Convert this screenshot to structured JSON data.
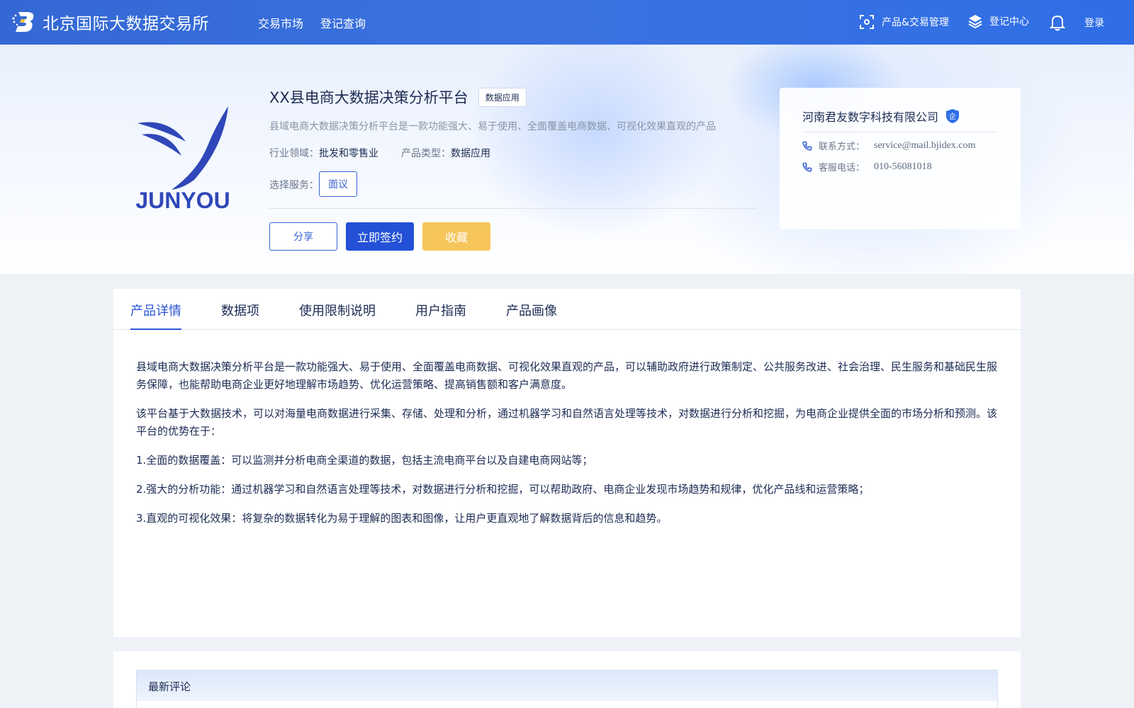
{
  "header": {
    "brand": "北京国际大数据交易所",
    "nav": [
      "交易市场",
      "登记查询"
    ],
    "product_mgmt": "产品&交易管理",
    "register_center": "登记中心",
    "login": "登录",
    "icons": [
      "scan-icon",
      "layers-icon",
      "bell-icon"
    ]
  },
  "product": {
    "logo_text": "JUNYOU",
    "title": "XX县电商大数据决策分析平台",
    "tag": "数据应用",
    "description": "县域电商大数据决策分析平台是一款功能强大、易于使用、全面覆盖电商数据、可视化效果直观的产品",
    "industry_label": "行业领域：",
    "industry_value": "批发和零售业",
    "type_label": "产品类型：",
    "type_value": "数据应用",
    "service_label": "选择服务：",
    "service_option": "面议",
    "buttons": {
      "share": "分享",
      "sign": "立即签约",
      "favorite": "收藏"
    }
  },
  "company": {
    "name": "河南君友数字科技有限公司",
    "badge": "企",
    "contact_label": "联系方式：",
    "contact_value": "service@mail.bjidex.com",
    "phone_label": "客服电话：",
    "phone_value": "010-56081018"
  },
  "tabs": [
    "产品详情",
    "数据项",
    "使用限制说明",
    "用户指南",
    "产品画像"
  ],
  "active_tab": "产品详情",
  "detail": {
    "paragraphs": [
      "县域电商大数据决策分析平台是一款功能强大、易于使用、全面覆盖电商数据、可视化效果直观的产品，可以辅助政府进行政策制定、公共服务改进、社会治理、民生服务和基础民生服务保障，也能帮助电商企业更好地理解市场趋势、优化运营策略、提高销售额和客户满意度。",
      "该平台基于大数据技术，可以对海量电商数据进行采集、存储、处理和分析，通过机器学习和自然语言处理等技术，对数据进行分析和挖掘，为电商企业提供全面的市场分析和预测。该平台的优势在于：",
      "1.全面的数据覆盖：可以监测并分析电商全渠道的数据，包括主流电商平台以及自建电商网站等；",
      "2.强大的分析功能：通过机器学习和自然语言处理等技术，对数据进行分析和挖掘，可以帮助政府、电商企业发现市场趋势和规律，优化产品线和运营策略；",
      "3.直观的可视化效果：将复杂的数据转化为易于理解的图表和图像，让用户更直观地了解数据背后的信息和趋势。"
    ]
  },
  "comments": {
    "title": "最新评论"
  },
  "colors": {
    "primary": "#2350d7",
    "accent": "#f6c65b",
    "nav_bg": "#3a73e0"
  }
}
